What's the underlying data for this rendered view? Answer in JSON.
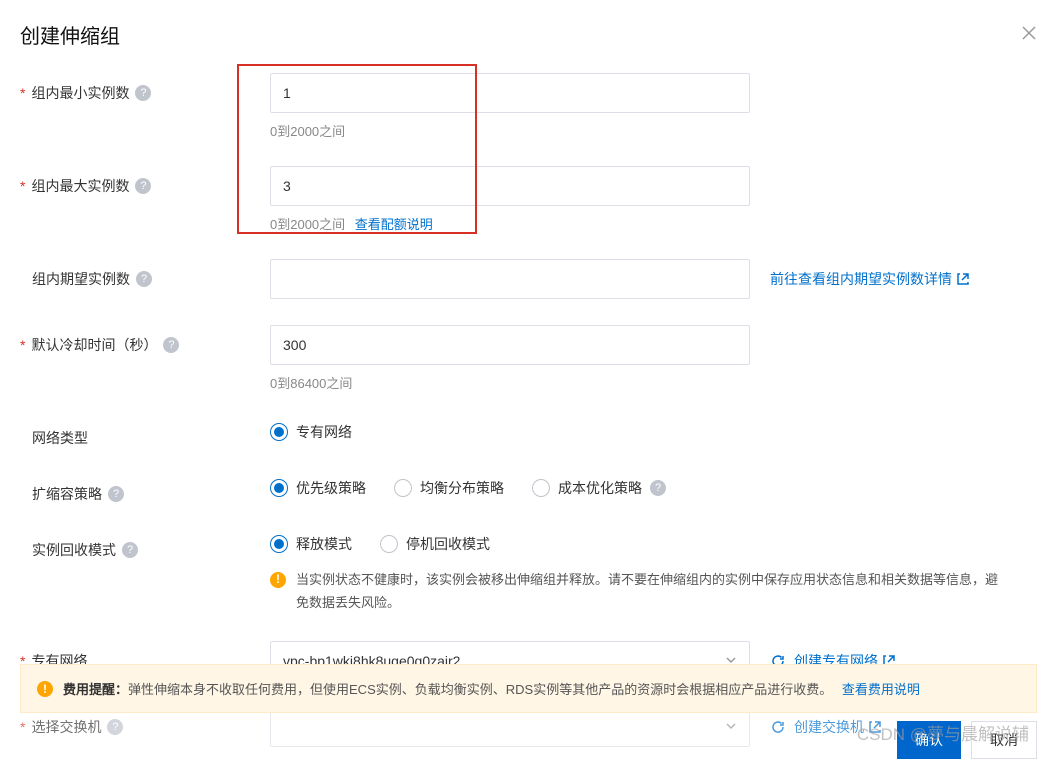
{
  "dialog": {
    "title": "创建伸缩组"
  },
  "form": {
    "minInstances": {
      "label": "组内最小实例数",
      "value": "1",
      "hint": "0到2000之间"
    },
    "maxInstances": {
      "label": "组内最大实例数",
      "value": "3",
      "hint": "0到2000之间",
      "quotaLink": "查看配额说明"
    },
    "expectedInstances": {
      "label": "组内期望实例数",
      "value": "",
      "sideLink": "前往查看组内期望实例数详情"
    },
    "cooldown": {
      "label": "默认冷却时间（秒）",
      "value": "300",
      "hint": "0到86400之间"
    },
    "networkType": {
      "label": "网络类型",
      "options": {
        "vpc": "专有网络"
      },
      "selected": "vpc"
    },
    "scalingPolicy": {
      "label": "扩缩容策略",
      "options": {
        "priority": "优先级策略",
        "balanced": "均衡分布策略",
        "cost": "成本优化策略"
      },
      "selected": "priority"
    },
    "reclaimMode": {
      "label": "实例回收模式",
      "options": {
        "release": "释放模式",
        "shutdown": "停机回收模式"
      },
      "selected": "release",
      "warning": "当实例状态不健康时，该实例会被移出伸缩组并释放。请不要在伸缩组内的实例中保存应用状态信息和相关数据等信息，避免数据丢失风险。"
    },
    "vpc": {
      "label": "专有网络",
      "value": "vpc-bp1wkj8hk8uge0q0zair2",
      "createLink": "创建专有网络"
    },
    "vswitch": {
      "label": "选择交换机",
      "createLink": "创建交换机"
    }
  },
  "banner": {
    "title": "费用提醒：",
    "text": "弹性伸缩本身不收取任何费用，但使用ECS实例、负载均衡实例、RDS实例等其他产品的资源时会根据相应产品进行收费。",
    "link": "查看费用说明"
  },
  "buttons": {
    "confirm": "确认",
    "cancel": "取消"
  },
  "watermark": "CSDN @夢与晨解说辅"
}
